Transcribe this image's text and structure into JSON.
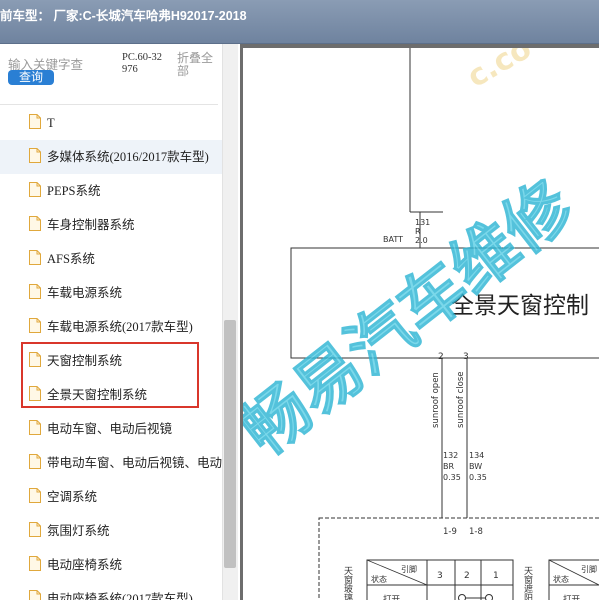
{
  "header": {
    "title": "前车型： 厂家:C-长城汽车哈弗H92017-2018"
  },
  "search": {
    "placeholder": "输入关键字查",
    "button_label": "查询",
    "pc_code": "PC.60-32976",
    "collapse_label": "折叠全部"
  },
  "sidebar": {
    "items": [
      {
        "label": "T"
      },
      {
        "label": "多媒体系统(2016/2017款车型)"
      },
      {
        "label": "PEPS系统"
      },
      {
        "label": "车身控制器系统"
      },
      {
        "label": "AFS系统"
      },
      {
        "label": "车载电源系统"
      },
      {
        "label": "车载电源系统(2017款车型)"
      },
      {
        "label": "天窗控制系统"
      },
      {
        "label": "全景天窗控制系统"
      },
      {
        "label": "电动车窗、电动后视镜"
      },
      {
        "label": "带电动车窗、电动后视镜、电动"
      },
      {
        "label": "空调系统"
      },
      {
        "label": "氛围灯系统"
      },
      {
        "label": "电动座椅系统"
      },
      {
        "label": "电动座椅系统(2017款车型)"
      }
    ]
  },
  "diagram": {
    "module_title": "全景天窗控制",
    "batt_label": "BATT",
    "batt_pin": "1 3",
    "wire_top_code": "131",
    "wire_top_color": "R",
    "wire_top_size": "2.0",
    "pin_2": "2",
    "pin_3": "3",
    "signal_open": "sunroof open",
    "signal_close": "sunroof close",
    "wire_left_code": "132",
    "wire_left_color": "BR",
    "wire_left_size": "0.35",
    "wire_right_code": "134",
    "wire_right_color": "BW",
    "wire_right_size": "0.35",
    "conn_left": "1-9",
    "conn_right": "1-8",
    "switch_left_name": "天窗玻璃",
    "switch_right_name": "天窗遮阳",
    "state_label": "状态",
    "pin_label": "引脚",
    "open_label": "打开",
    "col_3": "3",
    "col_2": "2",
    "col_1": "1",
    "watermark": "畅易汽车维修",
    "watermark_url": "c.co"
  },
  "colors": {
    "accent": "#2a7fd4",
    "highlight": "#d9362b",
    "watermark": "#5fd0e6"
  }
}
